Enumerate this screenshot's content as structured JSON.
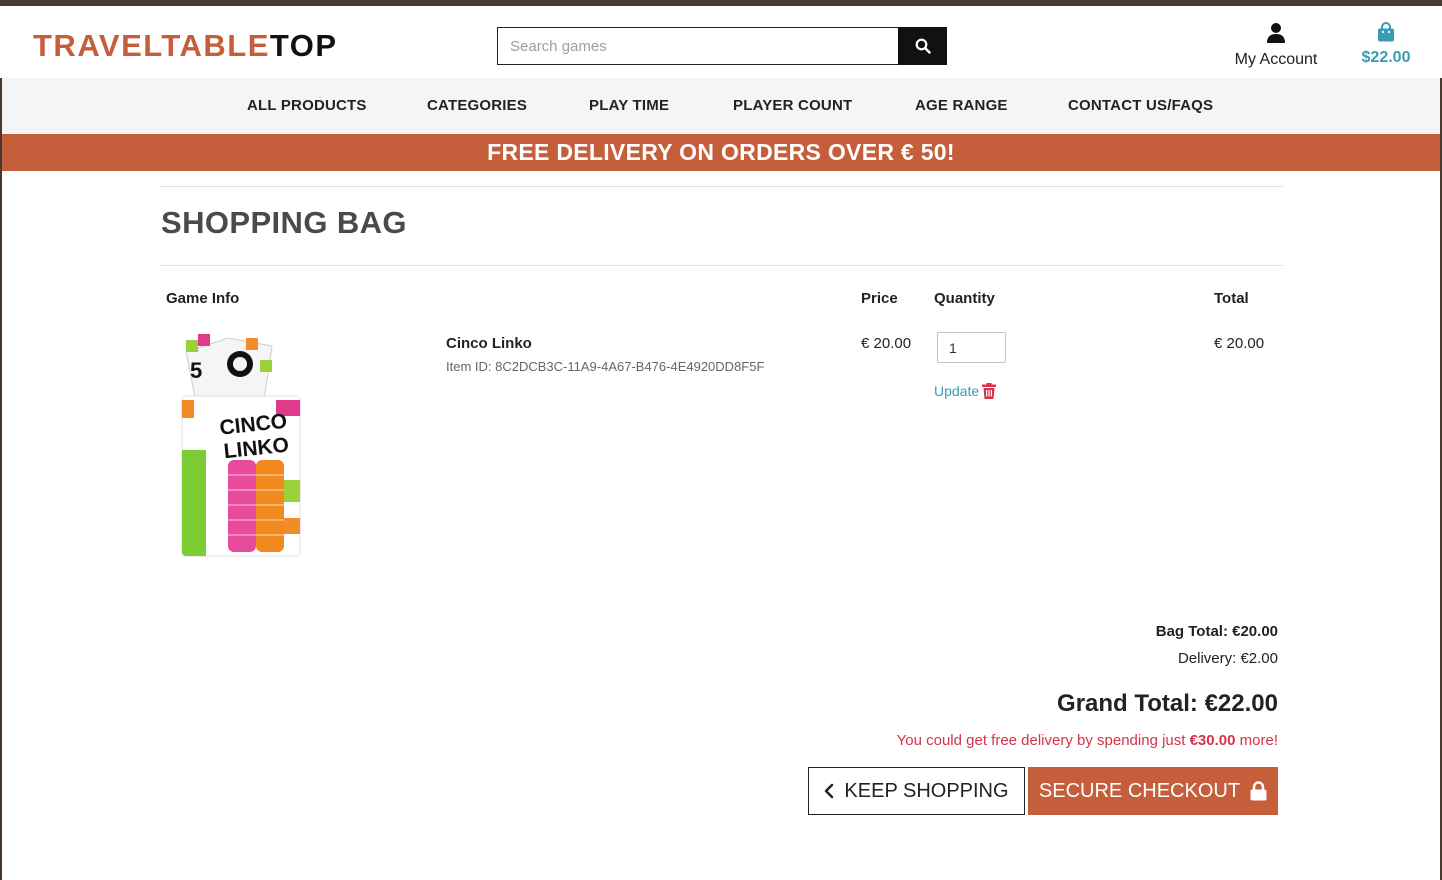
{
  "logo": {
    "part1": "TRAVELTABLE",
    "part2": "TOP"
  },
  "search": {
    "placeholder": "Search games"
  },
  "account": {
    "label": "My Account"
  },
  "bag": {
    "amount": "$22.00"
  },
  "nav": {
    "items": [
      {
        "label": "ALL PRODUCTS"
      },
      {
        "label": "CATEGORIES"
      },
      {
        "label": "PLAY TIME"
      },
      {
        "label": "PLAYER COUNT"
      },
      {
        "label": "AGE RANGE"
      },
      {
        "label": "CONTACT US/FAQS"
      }
    ]
  },
  "promo": {
    "text": "FREE DELIVERY ON ORDERS OVER € 50!"
  },
  "page": {
    "title": "SHOPPING BAG"
  },
  "table": {
    "headers": {
      "info": "Game Info",
      "price": "Price",
      "quantity": "Quantity",
      "total": "Total"
    },
    "rows": [
      {
        "name": "Cinco Linko",
        "item_id": "Item ID: 8C2DCB3C-11A9-4A67-B476-4E4920DD8F5F",
        "price": "€ 20.00",
        "quantity": "1",
        "total": "€ 20.00",
        "update_label": "Update",
        "box_text_top": "CINCO",
        "box_text_bottom": "LINKO",
        "box_badge": "5"
      }
    ]
  },
  "summary": {
    "bag_total": "Bag Total: €20.00",
    "delivery": "Delivery: €2.00",
    "grand_total": "Grand Total: €22.00",
    "note_prefix": "You could get free delivery by spending just ",
    "note_amount": "€30.00",
    "note_suffix": " more!"
  },
  "buttons": {
    "keep_shopping": "KEEP SHOPPING",
    "checkout": "SECURE CHECKOUT"
  },
  "colors": {
    "brand": "#c45e3b",
    "accent": "#3a9bb5",
    "danger": "#d63348"
  }
}
